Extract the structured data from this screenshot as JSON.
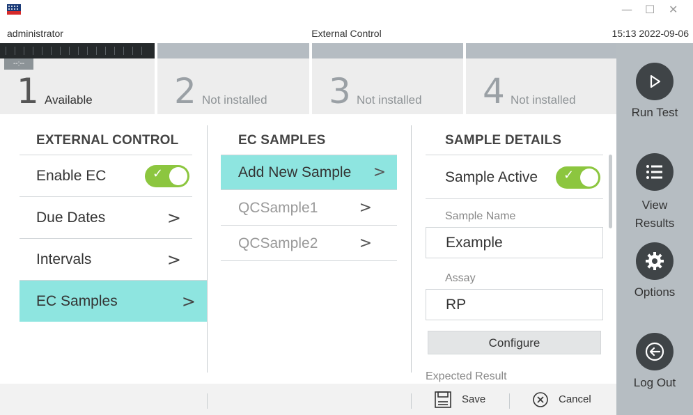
{
  "window": {
    "minimize": "—",
    "maximize": "☐",
    "close": "✕"
  },
  "status": {
    "user": "administrator",
    "title": "External Control",
    "datetime": "15:13 2022-09-06"
  },
  "modules": [
    {
      "number": "1",
      "label": "Available",
      "tag": "--:--"
    },
    {
      "number": "2",
      "label": "Not installed"
    },
    {
      "number": "3",
      "label": "Not installed"
    },
    {
      "number": "4",
      "label": "Not installed"
    }
  ],
  "sidebar": {
    "run_test": "Run Test",
    "view_results_1": "View",
    "view_results_2": "Results",
    "options": "Options",
    "log_out": "Log Out"
  },
  "external_control": {
    "heading": "EXTERNAL CONTROL",
    "items": [
      {
        "label": "Enable EC"
      },
      {
        "label": "Due Dates"
      },
      {
        "label": "Intervals"
      },
      {
        "label": "EC Samples"
      }
    ]
  },
  "ec_samples": {
    "heading": "EC SAMPLES",
    "items": [
      {
        "label": "Add New Sample"
      },
      {
        "label": "QCSample1"
      },
      {
        "label": "QCSample2"
      }
    ]
  },
  "sample_details": {
    "heading": "SAMPLE DETAILS",
    "active_label": "Sample Active",
    "name_label": "Sample Name",
    "name_value": "Example",
    "assay_label": "Assay",
    "assay_value": "RP",
    "configure": "Configure",
    "expected_label": "Expected Result"
  },
  "bottom": {
    "save": "Save",
    "cancel": "Cancel"
  },
  "colors": {
    "accent_selected": "#8ee5e0",
    "toggle_on": "#8cc63f",
    "sidebar_bg": "#b6bdc2"
  }
}
